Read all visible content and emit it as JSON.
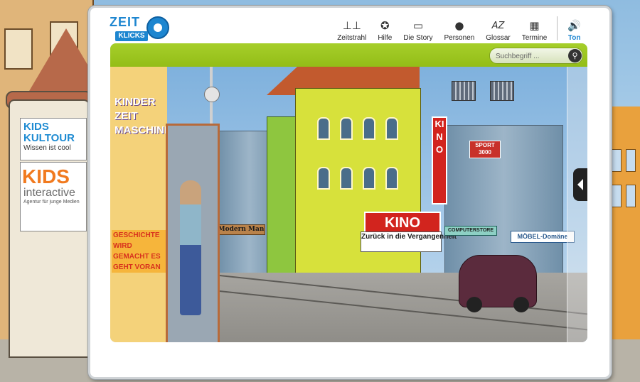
{
  "background": {
    "poster1_line1": "KIDS",
    "poster1_line2": "KULTOUR",
    "poster1_tagline": "Wissen ist cool",
    "poster2_title": "KIDS",
    "poster2_sub": "interactive",
    "poster2_tagline": "Agentur für junge Medien"
  },
  "logo": {
    "top": "ZEIT",
    "bottom": "KLICKS"
  },
  "nav": [
    {
      "label": "Zeitstrahl",
      "icon": "timeline-icon",
      "glyph": "⊥⊥"
    },
    {
      "label": "Hilfe",
      "icon": "help-icon",
      "glyph": "✪"
    },
    {
      "label": "Die Story",
      "icon": "story-icon",
      "glyph": "▭"
    },
    {
      "label": "Personen",
      "icon": "person-icon",
      "glyph": "●"
    },
    {
      "label": "Glossar",
      "icon": "glossary-icon",
      "glyph": "AZ"
    },
    {
      "label": "Termine",
      "icon": "calendar-icon",
      "glyph": "▦"
    },
    {
      "label": "Ton",
      "icon": "sound-icon",
      "glyph": "🔊"
    }
  ],
  "search": {
    "placeholder": "Suchbegriff ..."
  },
  "scene": {
    "kiosk_title": "KINDER ZEIT MASCHINE",
    "kiosk_slogan": "GESCHICHTE WIRD GEMACHT ES GEHT VORAN",
    "sign_modern": "Modern Man",
    "sign_kino": "KINO",
    "sign_zurueck": "Zurück in die Vergangenheit",
    "sign_kino_vertical": "KINO",
    "sign_sport": "SPORT 3000",
    "sign_computer": "COMPUTERSTORE",
    "sign_moebel": "MÖBEL-Domäne"
  },
  "colors": {
    "accent": "#1d86d0",
    "greenbar": "#9cc624",
    "kino_red": "#d2241e"
  }
}
